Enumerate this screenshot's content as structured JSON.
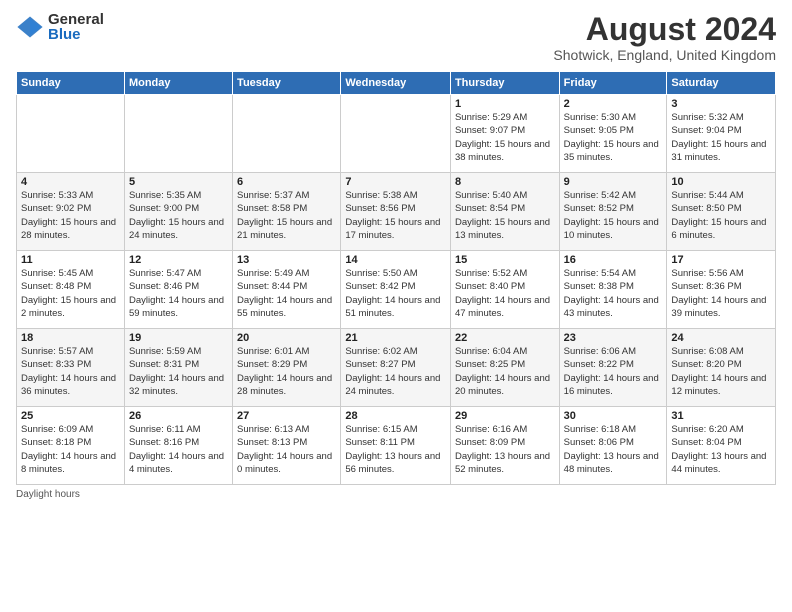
{
  "logo": {
    "general": "General",
    "blue": "Blue"
  },
  "title": "August 2024",
  "subtitle": "Shotwick, England, United Kingdom",
  "columns": [
    "Sunday",
    "Monday",
    "Tuesday",
    "Wednesday",
    "Thursday",
    "Friday",
    "Saturday"
  ],
  "footer": "Daylight hours",
  "weeks": [
    [
      {
        "day": "",
        "sunrise": "",
        "sunset": "",
        "daylight": ""
      },
      {
        "day": "",
        "sunrise": "",
        "sunset": "",
        "daylight": ""
      },
      {
        "day": "",
        "sunrise": "",
        "sunset": "",
        "daylight": ""
      },
      {
        "day": "",
        "sunrise": "",
        "sunset": "",
        "daylight": ""
      },
      {
        "day": "1",
        "sunrise": "Sunrise: 5:29 AM",
        "sunset": "Sunset: 9:07 PM",
        "daylight": "Daylight: 15 hours and 38 minutes."
      },
      {
        "day": "2",
        "sunrise": "Sunrise: 5:30 AM",
        "sunset": "Sunset: 9:05 PM",
        "daylight": "Daylight: 15 hours and 35 minutes."
      },
      {
        "day": "3",
        "sunrise": "Sunrise: 5:32 AM",
        "sunset": "Sunset: 9:04 PM",
        "daylight": "Daylight: 15 hours and 31 minutes."
      }
    ],
    [
      {
        "day": "4",
        "sunrise": "Sunrise: 5:33 AM",
        "sunset": "Sunset: 9:02 PM",
        "daylight": "Daylight: 15 hours and 28 minutes."
      },
      {
        "day": "5",
        "sunrise": "Sunrise: 5:35 AM",
        "sunset": "Sunset: 9:00 PM",
        "daylight": "Daylight: 15 hours and 24 minutes."
      },
      {
        "day": "6",
        "sunrise": "Sunrise: 5:37 AM",
        "sunset": "Sunset: 8:58 PM",
        "daylight": "Daylight: 15 hours and 21 minutes."
      },
      {
        "day": "7",
        "sunrise": "Sunrise: 5:38 AM",
        "sunset": "Sunset: 8:56 PM",
        "daylight": "Daylight: 15 hours and 17 minutes."
      },
      {
        "day": "8",
        "sunrise": "Sunrise: 5:40 AM",
        "sunset": "Sunset: 8:54 PM",
        "daylight": "Daylight: 15 hours and 13 minutes."
      },
      {
        "day": "9",
        "sunrise": "Sunrise: 5:42 AM",
        "sunset": "Sunset: 8:52 PM",
        "daylight": "Daylight: 15 hours and 10 minutes."
      },
      {
        "day": "10",
        "sunrise": "Sunrise: 5:44 AM",
        "sunset": "Sunset: 8:50 PM",
        "daylight": "Daylight: 15 hours and 6 minutes."
      }
    ],
    [
      {
        "day": "11",
        "sunrise": "Sunrise: 5:45 AM",
        "sunset": "Sunset: 8:48 PM",
        "daylight": "Daylight: 15 hours and 2 minutes."
      },
      {
        "day": "12",
        "sunrise": "Sunrise: 5:47 AM",
        "sunset": "Sunset: 8:46 PM",
        "daylight": "Daylight: 14 hours and 59 minutes."
      },
      {
        "day": "13",
        "sunrise": "Sunrise: 5:49 AM",
        "sunset": "Sunset: 8:44 PM",
        "daylight": "Daylight: 14 hours and 55 minutes."
      },
      {
        "day": "14",
        "sunrise": "Sunrise: 5:50 AM",
        "sunset": "Sunset: 8:42 PM",
        "daylight": "Daylight: 14 hours and 51 minutes."
      },
      {
        "day": "15",
        "sunrise": "Sunrise: 5:52 AM",
        "sunset": "Sunset: 8:40 PM",
        "daylight": "Daylight: 14 hours and 47 minutes."
      },
      {
        "day": "16",
        "sunrise": "Sunrise: 5:54 AM",
        "sunset": "Sunset: 8:38 PM",
        "daylight": "Daylight: 14 hours and 43 minutes."
      },
      {
        "day": "17",
        "sunrise": "Sunrise: 5:56 AM",
        "sunset": "Sunset: 8:36 PM",
        "daylight": "Daylight: 14 hours and 39 minutes."
      }
    ],
    [
      {
        "day": "18",
        "sunrise": "Sunrise: 5:57 AM",
        "sunset": "Sunset: 8:33 PM",
        "daylight": "Daylight: 14 hours and 36 minutes."
      },
      {
        "day": "19",
        "sunrise": "Sunrise: 5:59 AM",
        "sunset": "Sunset: 8:31 PM",
        "daylight": "Daylight: 14 hours and 32 minutes."
      },
      {
        "day": "20",
        "sunrise": "Sunrise: 6:01 AM",
        "sunset": "Sunset: 8:29 PM",
        "daylight": "Daylight: 14 hours and 28 minutes."
      },
      {
        "day": "21",
        "sunrise": "Sunrise: 6:02 AM",
        "sunset": "Sunset: 8:27 PM",
        "daylight": "Daylight: 14 hours and 24 minutes."
      },
      {
        "day": "22",
        "sunrise": "Sunrise: 6:04 AM",
        "sunset": "Sunset: 8:25 PM",
        "daylight": "Daylight: 14 hours and 20 minutes."
      },
      {
        "day": "23",
        "sunrise": "Sunrise: 6:06 AM",
        "sunset": "Sunset: 8:22 PM",
        "daylight": "Daylight: 14 hours and 16 minutes."
      },
      {
        "day": "24",
        "sunrise": "Sunrise: 6:08 AM",
        "sunset": "Sunset: 8:20 PM",
        "daylight": "Daylight: 14 hours and 12 minutes."
      }
    ],
    [
      {
        "day": "25",
        "sunrise": "Sunrise: 6:09 AM",
        "sunset": "Sunset: 8:18 PM",
        "daylight": "Daylight: 14 hours and 8 minutes."
      },
      {
        "day": "26",
        "sunrise": "Sunrise: 6:11 AM",
        "sunset": "Sunset: 8:16 PM",
        "daylight": "Daylight: 14 hours and 4 minutes."
      },
      {
        "day": "27",
        "sunrise": "Sunrise: 6:13 AM",
        "sunset": "Sunset: 8:13 PM",
        "daylight": "Daylight: 14 hours and 0 minutes."
      },
      {
        "day": "28",
        "sunrise": "Sunrise: 6:15 AM",
        "sunset": "Sunset: 8:11 PM",
        "daylight": "Daylight: 13 hours and 56 minutes."
      },
      {
        "day": "29",
        "sunrise": "Sunrise: 6:16 AM",
        "sunset": "Sunset: 8:09 PM",
        "daylight": "Daylight: 13 hours and 52 minutes."
      },
      {
        "day": "30",
        "sunrise": "Sunrise: 6:18 AM",
        "sunset": "Sunset: 8:06 PM",
        "daylight": "Daylight: 13 hours and 48 minutes."
      },
      {
        "day": "31",
        "sunrise": "Sunrise: 6:20 AM",
        "sunset": "Sunset: 8:04 PM",
        "daylight": "Daylight: 13 hours and 44 minutes."
      }
    ]
  ]
}
